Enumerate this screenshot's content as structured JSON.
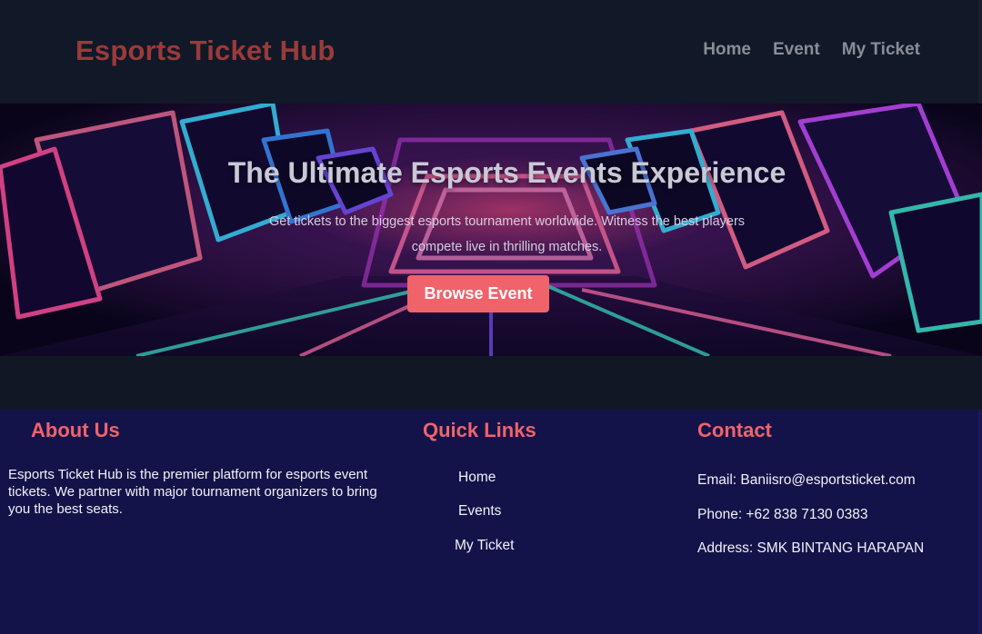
{
  "header": {
    "brand": "Esports Ticket Hub",
    "nav": [
      "Home",
      "Event",
      "My Ticket"
    ]
  },
  "hero": {
    "title": "The Ultimate Esports Events Experience",
    "subtitle": "Get tickets to the biggest esports tournament worldwide. Witness the best players compete live in thrilling matches.",
    "button_label": "Browse Event"
  },
  "footer": {
    "about": {
      "title": "About Us",
      "text": "Esports Ticket Hub is the premier platform for esports event tickets. We partner with major tournament organizers to bring you the best seats."
    },
    "quick_links": {
      "title": "Quick Links",
      "items": [
        "Home",
        "Events",
        "My Ticket"
      ]
    },
    "contact": {
      "title": "Contact",
      "email": "Email: Baniisro@esportsticket.com",
      "phone": "Phone: +62 838 7130 0383",
      "address": "Address: SMK BINTANG HARAPAN"
    }
  },
  "colors": {
    "accent": "#f0636a",
    "header_bg": "#111827",
    "footer_bg": "#141349",
    "brand": "#9b3a3a"
  }
}
